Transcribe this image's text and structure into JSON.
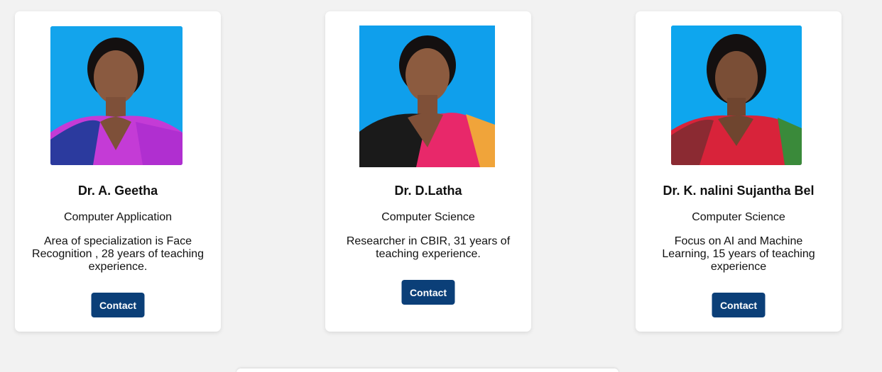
{
  "faculty": [
    {
      "name": "Dr. A. Geetha",
      "department": "Computer Application",
      "description": "Area of specialization is Face Recognition , 28 years of teaching experience.",
      "button_label": "Contact",
      "photo": {
        "background": "#13a4ec",
        "saree_color": "#c43bd6",
        "border_color": "#2b3a9e"
      }
    },
    {
      "name": "Dr. D.Latha",
      "department": "Computer Science",
      "description": "Researcher in CBIR, 31 years of teaching experience.",
      "button_label": "Contact",
      "photo": {
        "background": "#0f9fec",
        "saree_color": "#e8286a",
        "border_color": "#f0a43a"
      }
    },
    {
      "name": "Dr. K. nalini Sujantha Bel",
      "department": "Computer Science",
      "description": "Focus on AI and Machine Learning, 15 years of teaching experience",
      "button_label": "Contact",
      "photo": {
        "background": "#0ea6ee",
        "saree_color": "#d8233a",
        "border_color": "#3a8a3a"
      }
    }
  ],
  "colors": {
    "page_background": "#f2f2f2",
    "card_background": "#ffffff",
    "button_background": "#0b3f78",
    "button_text": "#ffffff"
  }
}
